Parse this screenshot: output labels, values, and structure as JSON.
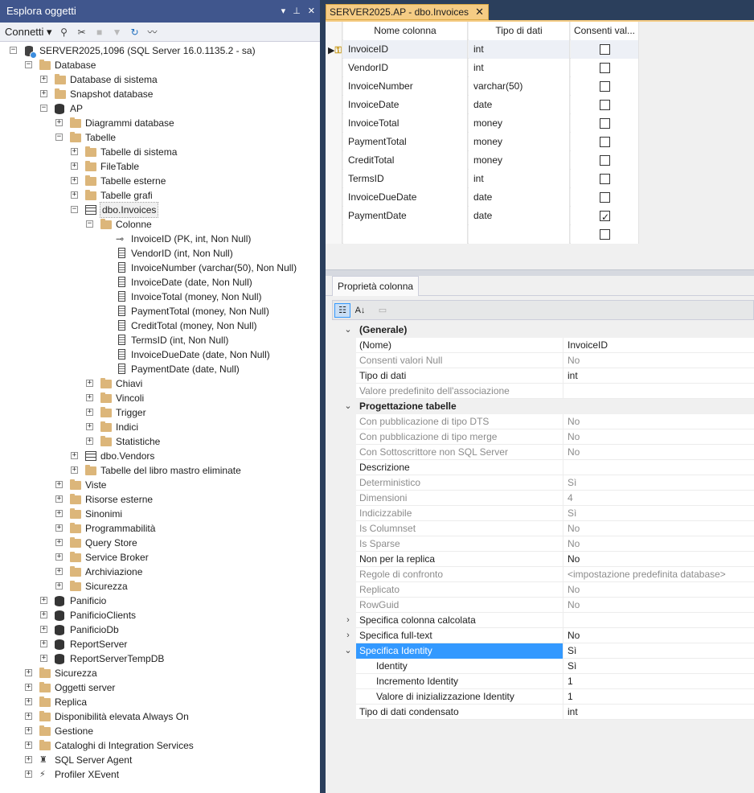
{
  "object_explorer": {
    "title": "Esplora oggetti",
    "title_buttons": [
      "▾",
      "⊥",
      "✕"
    ],
    "toolbar": {
      "connect_label": "Connetti ▾"
    },
    "tree": [
      {
        "label": "SERVER2025,1096 (SQL Server 16.0.1135.2 - sa)",
        "level": 0,
        "icon": "server-icon",
        "exp": "−"
      },
      {
        "label": "Database",
        "level": 1,
        "icon": "folder-icon",
        "exp": "−"
      },
      {
        "label": "Database di sistema",
        "level": 2,
        "icon": "folder-icon",
        "exp": "+"
      },
      {
        "label": "Snapshot database",
        "level": 2,
        "icon": "folder-icon",
        "exp": "+"
      },
      {
        "label": "AP",
        "level": 2,
        "icon": "database-icon",
        "exp": "−"
      },
      {
        "label": "Diagrammi database",
        "level": 3,
        "icon": "folder-icon",
        "exp": "+"
      },
      {
        "label": "Tabelle",
        "level": 3,
        "icon": "folder-icon",
        "exp": "−"
      },
      {
        "label": "Tabelle di sistema",
        "level": 4,
        "icon": "folder-icon",
        "exp": "+"
      },
      {
        "label": "FileTable",
        "level": 4,
        "icon": "folder-icon",
        "exp": "+"
      },
      {
        "label": "Tabelle esterne",
        "level": 4,
        "icon": "folder-icon",
        "exp": "+"
      },
      {
        "label": "Tabelle grafi",
        "level": 4,
        "icon": "folder-icon",
        "exp": "+"
      },
      {
        "label": "dbo.Invoices",
        "level": 4,
        "icon": "table-icon",
        "exp": "−",
        "selected": true
      },
      {
        "label": "Colonne",
        "level": 5,
        "icon": "folder-icon",
        "exp": "−"
      },
      {
        "label": "InvoiceID (PK, int, Non Null)",
        "level": 6,
        "icon": "key-icon",
        "exp": ""
      },
      {
        "label": "VendorID (int, Non Null)",
        "level": 6,
        "icon": "column-icon",
        "exp": ""
      },
      {
        "label": "InvoiceNumber (varchar(50), Non Null)",
        "level": 6,
        "icon": "column-icon",
        "exp": ""
      },
      {
        "label": "InvoiceDate (date, Non Null)",
        "level": 6,
        "icon": "column-icon",
        "exp": ""
      },
      {
        "label": "InvoiceTotal (money, Non Null)",
        "level": 6,
        "icon": "column-icon",
        "exp": ""
      },
      {
        "label": "PaymentTotal (money, Non Null)",
        "level": 6,
        "icon": "column-icon",
        "exp": ""
      },
      {
        "label": "CreditTotal (money, Non Null)",
        "level": 6,
        "icon": "column-icon",
        "exp": ""
      },
      {
        "label": "TermsID (int, Non Null)",
        "level": 6,
        "icon": "column-icon",
        "exp": ""
      },
      {
        "label": "InvoiceDueDate (date, Non Null)",
        "level": 6,
        "icon": "column-icon",
        "exp": ""
      },
      {
        "label": "PaymentDate (date, Null)",
        "level": 6,
        "icon": "column-icon",
        "exp": ""
      },
      {
        "label": "Chiavi",
        "level": 5,
        "icon": "folder-icon",
        "exp": "+"
      },
      {
        "label": "Vincoli",
        "level": 5,
        "icon": "folder-icon",
        "exp": "+"
      },
      {
        "label": "Trigger",
        "level": 5,
        "icon": "folder-icon",
        "exp": "+"
      },
      {
        "label": "Indici",
        "level": 5,
        "icon": "folder-icon",
        "exp": "+"
      },
      {
        "label": "Statistiche",
        "level": 5,
        "icon": "folder-icon",
        "exp": "+"
      },
      {
        "label": "dbo.Vendors",
        "level": 4,
        "icon": "table-icon",
        "exp": "+"
      },
      {
        "label": "Tabelle del libro mastro eliminate",
        "level": 4,
        "icon": "folder-icon",
        "exp": "+"
      },
      {
        "label": "Viste",
        "level": 3,
        "icon": "folder-icon",
        "exp": "+"
      },
      {
        "label": "Risorse esterne",
        "level": 3,
        "icon": "folder-icon",
        "exp": "+"
      },
      {
        "label": "Sinonimi",
        "level": 3,
        "icon": "folder-icon",
        "exp": "+"
      },
      {
        "label": "Programmabilità",
        "level": 3,
        "icon": "folder-icon",
        "exp": "+"
      },
      {
        "label": "Query Store",
        "level": 3,
        "icon": "folder-icon",
        "exp": "+"
      },
      {
        "label": "Service Broker",
        "level": 3,
        "icon": "folder-icon",
        "exp": "+"
      },
      {
        "label": "Archiviazione",
        "level": 3,
        "icon": "folder-icon",
        "exp": "+"
      },
      {
        "label": "Sicurezza",
        "level": 3,
        "icon": "folder-icon",
        "exp": "+"
      },
      {
        "label": "Panificio",
        "level": 2,
        "icon": "database-icon",
        "exp": "+"
      },
      {
        "label": "PanificioClients",
        "level": 2,
        "icon": "database-icon",
        "exp": "+"
      },
      {
        "label": "PanificioDb",
        "level": 2,
        "icon": "database-icon",
        "exp": "+"
      },
      {
        "label": "ReportServer",
        "level": 2,
        "icon": "database-icon",
        "exp": "+"
      },
      {
        "label": "ReportServerTempDB",
        "level": 2,
        "icon": "database-icon",
        "exp": "+"
      },
      {
        "label": "Sicurezza",
        "level": 1,
        "icon": "folder-icon",
        "exp": "+"
      },
      {
        "label": "Oggetti server",
        "level": 1,
        "icon": "folder-icon",
        "exp": "+"
      },
      {
        "label": "Replica",
        "level": 1,
        "icon": "folder-icon",
        "exp": "+"
      },
      {
        "label": "Disponibilità elevata Always On",
        "level": 1,
        "icon": "folder-icon",
        "exp": "+"
      },
      {
        "label": "Gestione",
        "level": 1,
        "icon": "folder-icon",
        "exp": "+"
      },
      {
        "label": "Cataloghi di Integration Services",
        "level": 1,
        "icon": "folder-icon",
        "exp": "+"
      },
      {
        "label": "SQL Server Agent",
        "level": 1,
        "icon": "agent-icon",
        "exp": "+"
      },
      {
        "label": "Profiler XEvent",
        "level": 1,
        "icon": "xevent-icon",
        "exp": "+"
      }
    ]
  },
  "document_tab": {
    "label": "SERVER2025.AP - dbo.Invoices",
    "close": "✕"
  },
  "designer": {
    "headers": [
      "Nome colonna",
      "Tipo di dati",
      "Consenti val..."
    ],
    "rows": [
      {
        "name": "InvoiceID",
        "type": "int",
        "allow_null": false,
        "key": true
      },
      {
        "name": "VendorID",
        "type": "int",
        "allow_null": false
      },
      {
        "name": "InvoiceNumber",
        "type": "varchar(50)",
        "allow_null": false
      },
      {
        "name": "InvoiceDate",
        "type": "date",
        "allow_null": false
      },
      {
        "name": "InvoiceTotal",
        "type": "money",
        "allow_null": false
      },
      {
        "name": "PaymentTotal",
        "type": "money",
        "allow_null": false
      },
      {
        "name": "CreditTotal",
        "type": "money",
        "allow_null": false
      },
      {
        "name": "TermsID",
        "type": "int",
        "allow_null": false
      },
      {
        "name": "InvoiceDueDate",
        "type": "date",
        "allow_null": false
      },
      {
        "name": "PaymentDate",
        "type": "date",
        "allow_null": true
      },
      {
        "name": "",
        "type": "",
        "allow_null": false
      }
    ]
  },
  "column_properties": {
    "tab_label": "Proprietà colonna",
    "rows": [
      {
        "kind": "cat",
        "name": "(Generale)",
        "toggle": "⌄"
      },
      {
        "kind": "prop",
        "name": "(Nome)",
        "value": "InvoiceID"
      },
      {
        "kind": "ro",
        "name": "Consenti valori Null",
        "value": "No"
      },
      {
        "kind": "prop",
        "name": "Tipo di dati",
        "value": "int"
      },
      {
        "kind": "ro",
        "name": "Valore predefinito dell'associazione",
        "value": ""
      },
      {
        "kind": "cat",
        "name": "Progettazione tabelle",
        "toggle": "⌄"
      },
      {
        "kind": "ro",
        "name": "Con pubblicazione di tipo DTS",
        "value": "No"
      },
      {
        "kind": "ro",
        "name": "Con pubblicazione di tipo merge",
        "value": "No"
      },
      {
        "kind": "ro",
        "name": "Con Sottoscrittore non SQL Server",
        "value": "No"
      },
      {
        "kind": "prop",
        "name": "Descrizione",
        "value": ""
      },
      {
        "kind": "ro",
        "name": "Deterministico",
        "value": "Sì"
      },
      {
        "kind": "ro",
        "name": "Dimensioni",
        "value": "4"
      },
      {
        "kind": "ro",
        "name": "Indicizzabile",
        "value": "Sì"
      },
      {
        "kind": "ro",
        "name": "Is Columnset",
        "value": "No"
      },
      {
        "kind": "ro",
        "name": "Is Sparse",
        "value": "No"
      },
      {
        "kind": "prop",
        "name": "Non per la replica",
        "value": "No"
      },
      {
        "kind": "ro",
        "name": "Regole di confronto",
        "value": "<impostazione predefinita database>"
      },
      {
        "kind": "ro",
        "name": "Replicato",
        "value": "No"
      },
      {
        "kind": "ro",
        "name": "RowGuid",
        "value": "No"
      },
      {
        "kind": "prop",
        "name": "Specifica colonna calcolata",
        "value": "",
        "toggle": "›"
      },
      {
        "kind": "prop",
        "name": "Specifica full-text",
        "value": "No",
        "toggle": "›"
      },
      {
        "kind": "sel",
        "name": "Specifica Identity",
        "value": "Sì",
        "toggle": "⌄"
      },
      {
        "kind": "sub",
        "name": "Identity",
        "value": "Sì"
      },
      {
        "kind": "sub",
        "name": "Incremento Identity",
        "value": "1"
      },
      {
        "kind": "sub",
        "name": "Valore di inizializzazione Identity",
        "value": "1"
      },
      {
        "kind": "prop",
        "name": "Tipo di dati condensato",
        "value": "int"
      }
    ]
  },
  "colors": {
    "title_bar": "#40568d",
    "doc_tab": "#f5cc84",
    "selection": "#3399ff",
    "folder": "#dcb67a"
  }
}
